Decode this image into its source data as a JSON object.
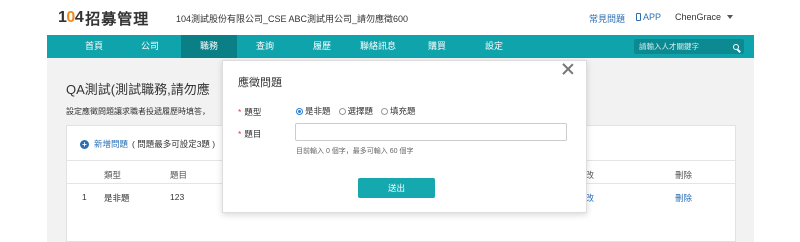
{
  "header": {
    "logo_number_a": "1",
    "logo_number_o": "0",
    "logo_number_b": "4",
    "logo_text": "招募管理",
    "company": "104測試股份有限公司_CSE ABC測試用公司_請勿應徵600",
    "faq": "常見問題",
    "app": "APP",
    "user": "ChenGrace"
  },
  "nav": {
    "items": [
      "首頁",
      "公司",
      "職務",
      "查詢",
      "履歷",
      "聯絡訊息",
      "購買",
      "設定"
    ],
    "active": "職務",
    "search_placeholder": "請輸入人才關鍵字"
  },
  "page": {
    "title": "QA測試(測試職務,請勿應",
    "desc": "設定應徵問題讓求職者投遞履歷時填答，",
    "add_link": "新增問題",
    "add_note": "( 問題最多可設定3題 )",
    "table": {
      "headers": [
        "類型",
        "題目",
        "修改",
        "刪除"
      ],
      "rows": [
        {
          "no": "1",
          "type": "是非題",
          "question": "123",
          "edit": "修改",
          "delete": "刪除"
        }
      ]
    }
  },
  "modal": {
    "title": "應徵問題",
    "type_label": "題型",
    "options": [
      "是非題",
      "選擇題",
      "填充題"
    ],
    "selected": "是非題",
    "question_label": "題目",
    "question_value": "",
    "hint": "目前輸入 0 個字，最多可輸入 60 個字",
    "submit": "送出"
  },
  "colors": {
    "nav_bg": "#0fa3ab",
    "nav_active": "#0b7f86",
    "link": "#2a6fb5",
    "button": "#15a8ae",
    "required": "#ee3333"
  }
}
